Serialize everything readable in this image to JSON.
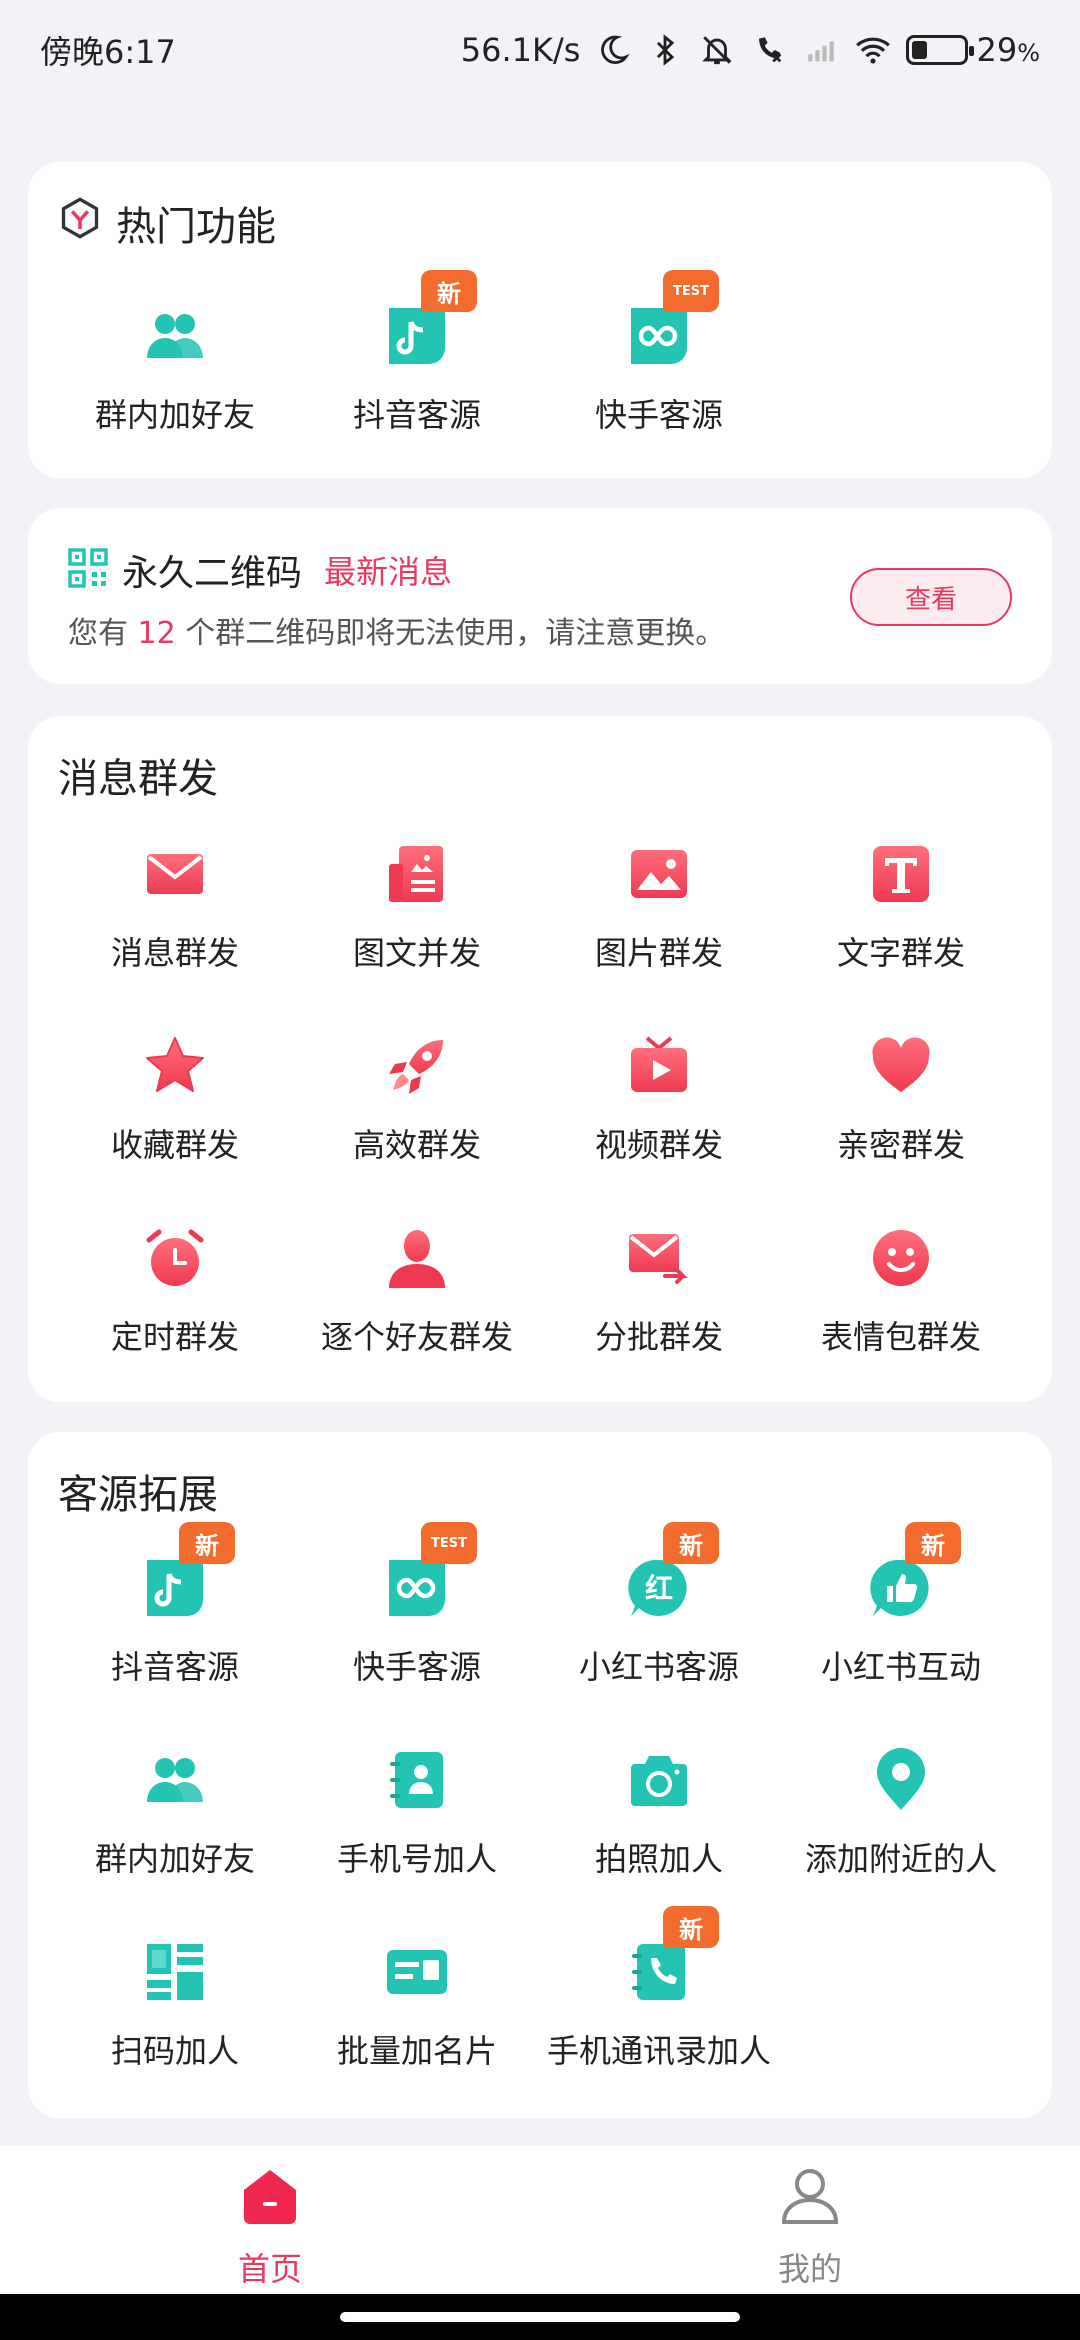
{
  "status_bar": {
    "time": "傍晚6:17",
    "speed": "56.1K/s",
    "battery": "29",
    "battery_unit": "%"
  },
  "hot": {
    "title": "热门功能",
    "items": [
      {
        "label": "群内加好友",
        "icon": "group-icon"
      },
      {
        "label": "抖音客源",
        "icon": "douyin-icon",
        "badge": "新"
      },
      {
        "label": "快手客源",
        "icon": "kuaishou-icon",
        "badge": "TEST"
      }
    ]
  },
  "qr": {
    "title": "永久二维码",
    "new_label": "最新消息",
    "desc_prefix": "您有",
    "count": "12",
    "desc_suffix": "个群二维码即将无法使用，请注意更换。",
    "button": "查看"
  },
  "broadcast": {
    "title": "消息群发",
    "items": [
      {
        "label": "消息群发",
        "icon": "envelope-icon"
      },
      {
        "label": "图文并发",
        "icon": "image-text-icon"
      },
      {
        "label": "图片群发",
        "icon": "picture-icon"
      },
      {
        "label": "文字群发",
        "icon": "text-t-icon"
      },
      {
        "label": "收藏群发",
        "icon": "star-icon"
      },
      {
        "label": "高效群发",
        "icon": "rocket-icon"
      },
      {
        "label": "视频群发",
        "icon": "tv-play-icon"
      },
      {
        "label": "亲密群发",
        "icon": "heart-icon"
      },
      {
        "label": "定时群发",
        "icon": "alarm-clock-icon"
      },
      {
        "label": "逐个好友群发",
        "icon": "person-icon"
      },
      {
        "label": "分批群发",
        "icon": "mail-forward-icon"
      },
      {
        "label": "表情包群发",
        "icon": "smiley-icon"
      }
    ]
  },
  "sources": {
    "title": "客源拓展",
    "items": [
      {
        "label": "抖音客源",
        "icon": "douyin-icon",
        "badge": "新"
      },
      {
        "label": "快手客源",
        "icon": "kuaishou-icon",
        "badge": "TEST"
      },
      {
        "label": "小红书客源",
        "icon": "xiaohongshu-icon",
        "badge": "新"
      },
      {
        "label": "小红书互动",
        "icon": "thumbs-up-icon",
        "badge": "新"
      },
      {
        "label": "群内加好友",
        "icon": "group-icon"
      },
      {
        "label": "手机号加人",
        "icon": "contact-book-icon"
      },
      {
        "label": "拍照加人",
        "icon": "camera-icon"
      },
      {
        "label": "添加附近的人",
        "icon": "location-pin-icon"
      },
      {
        "label": "扫码加人",
        "icon": "scan-grid-icon"
      },
      {
        "label": "批量加名片",
        "icon": "business-card-icon"
      },
      {
        "label": "手机通讯录加人",
        "icon": "phone-book-icon",
        "badge": "新"
      }
    ]
  },
  "nav": {
    "home": "首页",
    "mine": "我的"
  },
  "colors": {
    "accent": "#e8395f",
    "teal": "#23c4b4",
    "badge": "#f46b2e"
  }
}
